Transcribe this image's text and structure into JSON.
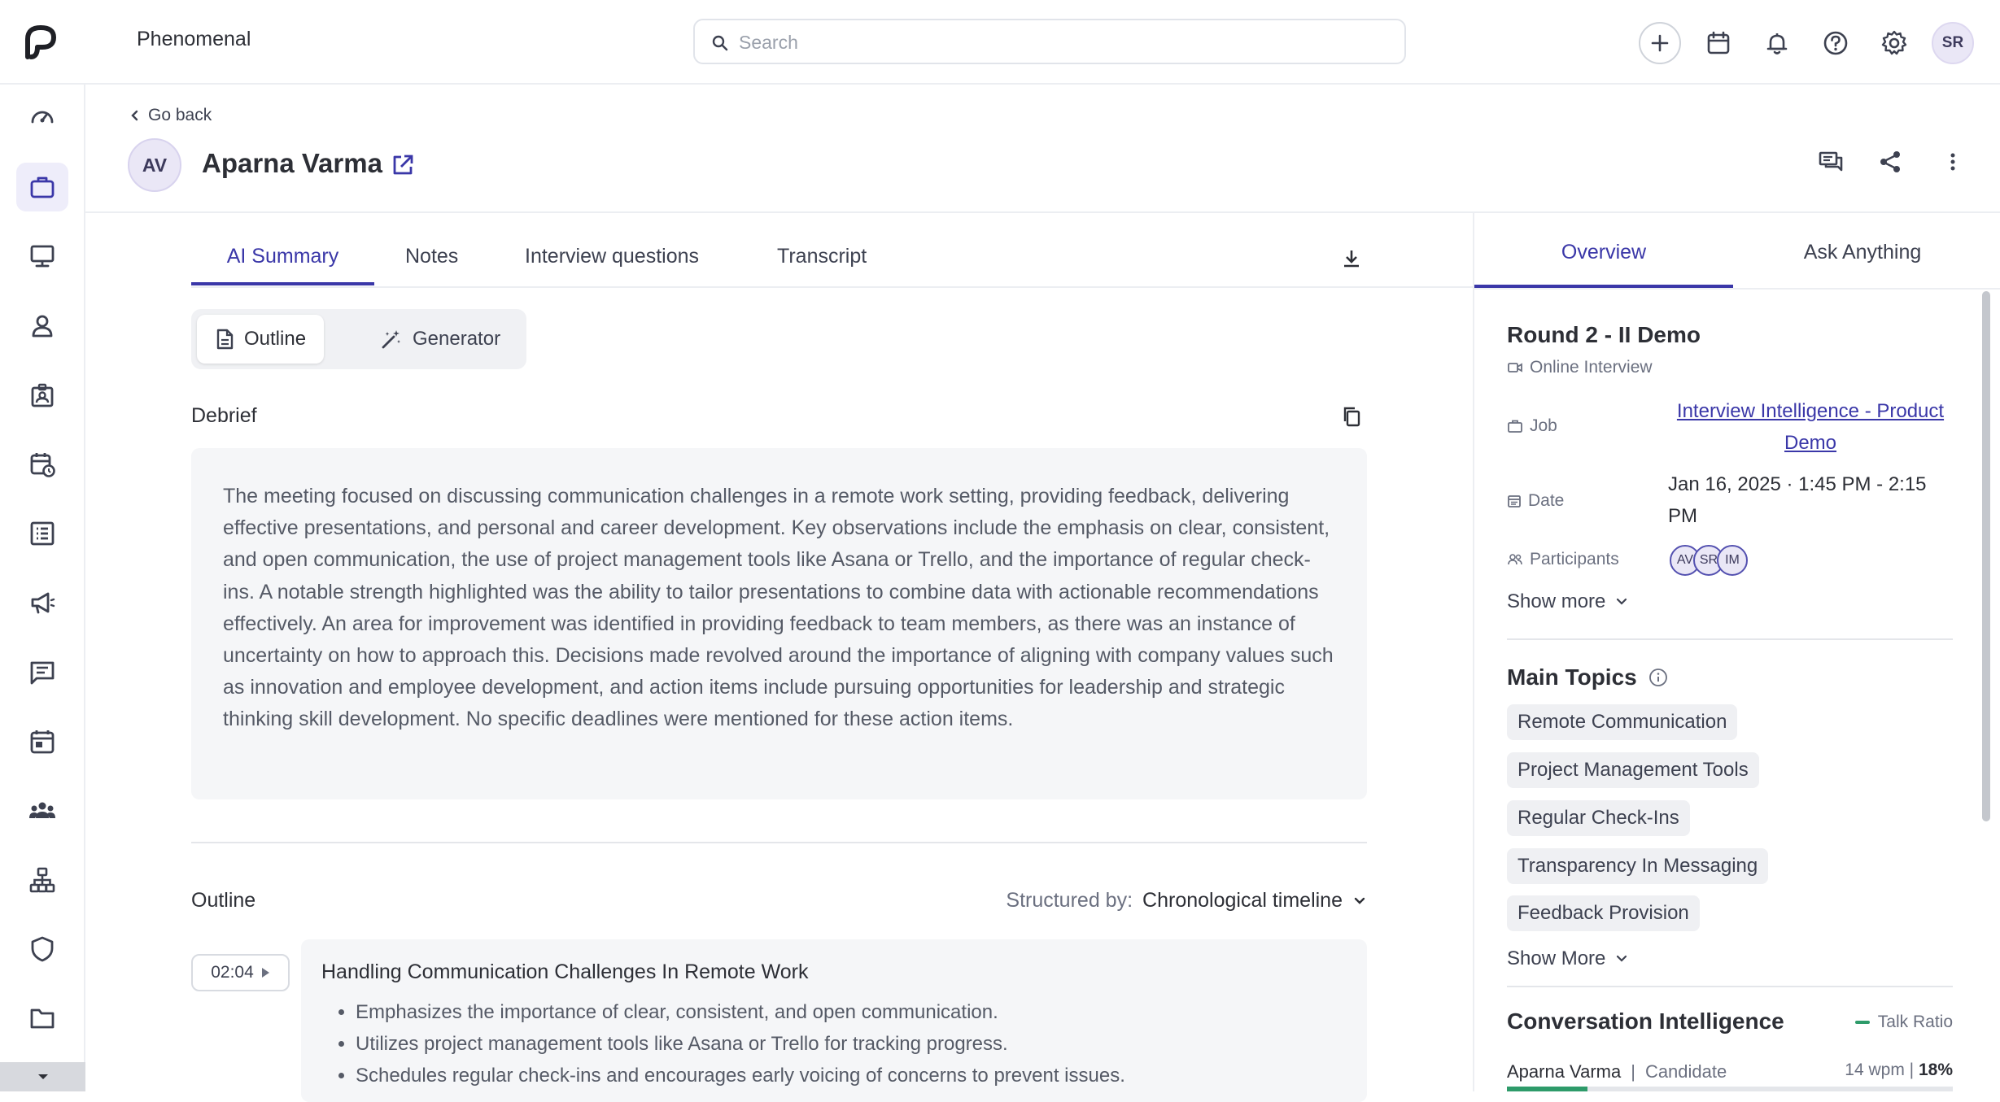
{
  "app": {
    "title": "Phenomenal"
  },
  "search": {
    "placeholder": "Search"
  },
  "top_actions": {
    "icons": [
      "plus-icon",
      "calendar-icon",
      "bell-icon",
      "help-icon",
      "gear-icon"
    ],
    "user_initials": "SR"
  },
  "sidebar": {
    "items": [
      {
        "icon": "dashboard-icon"
      },
      {
        "icon": "briefcase-icon",
        "active": true
      },
      {
        "icon": "presentation-icon"
      },
      {
        "icon": "person-icon"
      },
      {
        "icon": "id-badge-icon"
      },
      {
        "icon": "calendar-clock-icon"
      },
      {
        "icon": "checklist-icon"
      },
      {
        "icon": "megaphone-icon"
      },
      {
        "icon": "message-icon"
      },
      {
        "icon": "calendar-event-icon"
      },
      {
        "icon": "team-icon"
      },
      {
        "icon": "org-chart-icon"
      },
      {
        "icon": "shield-icon"
      },
      {
        "icon": "folder-icon"
      }
    ]
  },
  "header": {
    "back_label": "Go back",
    "candidate_initials": "AV",
    "candidate_name": "Aparna Varma"
  },
  "tabs": [
    {
      "label": "AI Summary",
      "active": true
    },
    {
      "label": "Notes"
    },
    {
      "label": "Interview questions"
    },
    {
      "label": "Transcript"
    }
  ],
  "segmented": {
    "outline": "Outline",
    "generator": "Generator",
    "active": "outline"
  },
  "debrief": {
    "title": "Debrief",
    "text": "The meeting focused on discussing communication challenges in a remote work setting, providing feedback, delivering effective presentations, and personal and career development. Key observations include the emphasis on clear, consistent, and open communication, the use of project management tools like Asana or Trello, and the importance of regular check-ins. A notable strength highlighted was the ability to tailor presentations to combine data with actionable recommendations effectively. An area for improvement was identified in providing feedback to team members, as there was an instance of uncertainty on how to approach this. Decisions made revolved around the importance of aligning with company values such as innovation and employee development, and action items include pursuing opportunities for leadership and strategic thinking skill development. No specific deadlines were mentioned for these action items."
  },
  "outline": {
    "title": "Outline",
    "structured_by_label": "Structured by:",
    "structured_by_value": "Chronological timeline",
    "items": [
      {
        "timestamp": "02:04",
        "heading": "Handling Communication Challenges In Remote Work",
        "bullets": [
          "Emphasizes the importance of clear, consistent, and open communication.",
          "Utilizes project management tools like Asana or Trello for tracking progress.",
          "Schedules regular check-ins and encourages early voicing of concerns to prevent issues."
        ]
      }
    ]
  },
  "right_panel": {
    "tabs": [
      {
        "label": "Overview",
        "active": true
      },
      {
        "label": "Ask Anything"
      }
    ],
    "round_title": "Round 2 - II Demo",
    "interview_type": "Online Interview",
    "job_label": "Job",
    "job_value": "Interview Intelligence - Product Demo",
    "date_label": "Date",
    "date_value": "Jan 16, 2025 · 1:45 PM - 2:15 PM",
    "participants_label": "Participants",
    "participants": [
      "AV",
      "SR",
      "IM"
    ],
    "show_more": "Show more",
    "topics_title": "Main Topics",
    "topics": [
      "Remote Communication",
      "Project Management Tools",
      "Regular Check-Ins",
      "Transparency In Messaging",
      "Feedback Provision"
    ],
    "topics_show_more": "Show More",
    "ci_title": "Conversation Intelligence",
    "talk_ratio_label": "Talk Ratio",
    "speaker_name": "Aparna Varma",
    "speaker_separator": "|",
    "speaker_role": "Candidate",
    "speaker_wpm": "14 wpm",
    "speaker_ratio_separator": "|",
    "speaker_ratio": "18%",
    "speaker_ratio_value": 0.18,
    "accent_color": "#3a37a8",
    "talk_color": "#2e9b6a"
  }
}
